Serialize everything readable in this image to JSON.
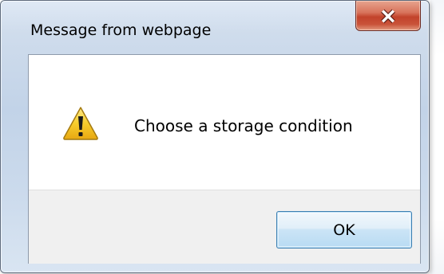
{
  "dialog": {
    "title": "Message from webpage",
    "message": "Choose a storage condition",
    "ok_label": "OK",
    "close_icon": "close-x-icon",
    "message_icon": "warning-icon"
  },
  "colors": {
    "close_button": "#c7462e",
    "ok_button_border": "#3c7fb1",
    "frame_border": "#8e9aab",
    "warning_fill": "#f5c61a"
  }
}
